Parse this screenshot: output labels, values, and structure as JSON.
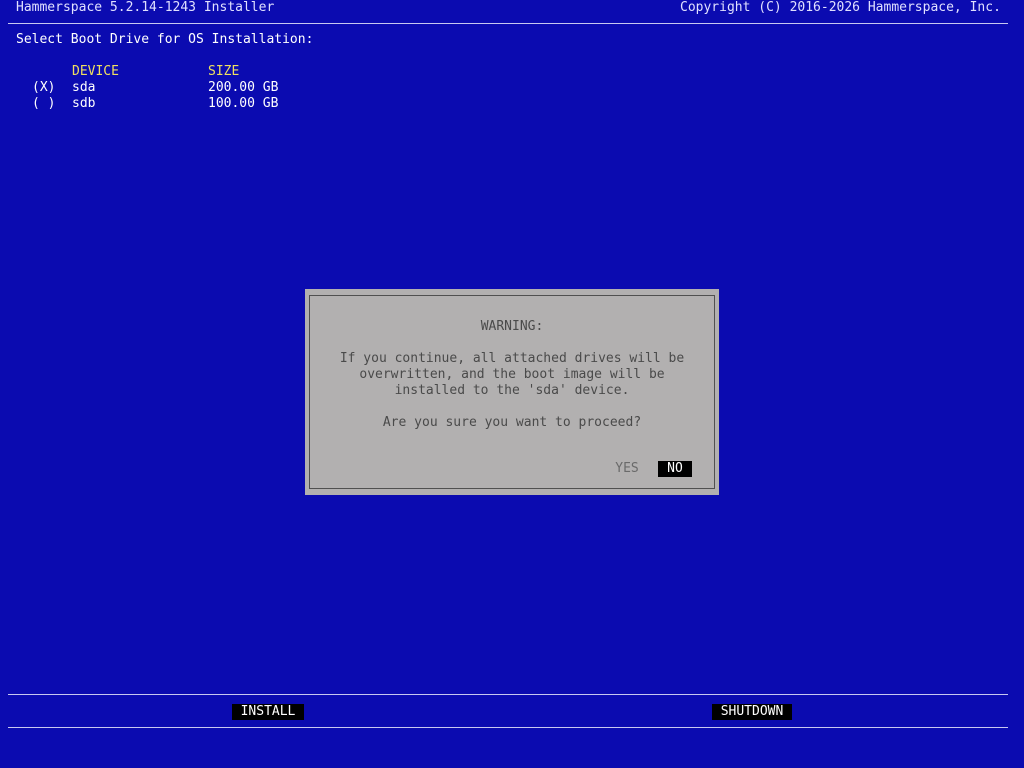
{
  "header": {
    "title": "Hammerspace 5.2.14-1243 Installer",
    "copyright": "Copyright (C) 2016-2026 Hammerspace, Inc."
  },
  "prompt": "Select Boot Drive for OS Installation:",
  "drive_table": {
    "columns": [
      "DEVICE",
      "SIZE"
    ],
    "rows": [
      {
        "selector": "(X)",
        "device": "sda",
        "size": "200.00 GB",
        "selected": true
      },
      {
        "selector": "( )",
        "device": "sdb",
        "size": "100.00 GB",
        "selected": false
      }
    ]
  },
  "dialog": {
    "title": "WARNING:",
    "message_lines": [
      "If you continue, all attached drives will be",
      "overwritten, and the boot image will be",
      "installed to the 'sda' device."
    ],
    "question": "Are you sure you want to proceed?",
    "yes_label": "YES",
    "no_label": "NO",
    "focused": "NO"
  },
  "footer": {
    "install_label": "INSTALL",
    "shutdown_label": "SHUTDOWN"
  },
  "colors": {
    "background": "#0b0bb0",
    "column_header": "#f0e060",
    "dialog_bg": "#b2b0b0",
    "button_bg": "#000000"
  }
}
